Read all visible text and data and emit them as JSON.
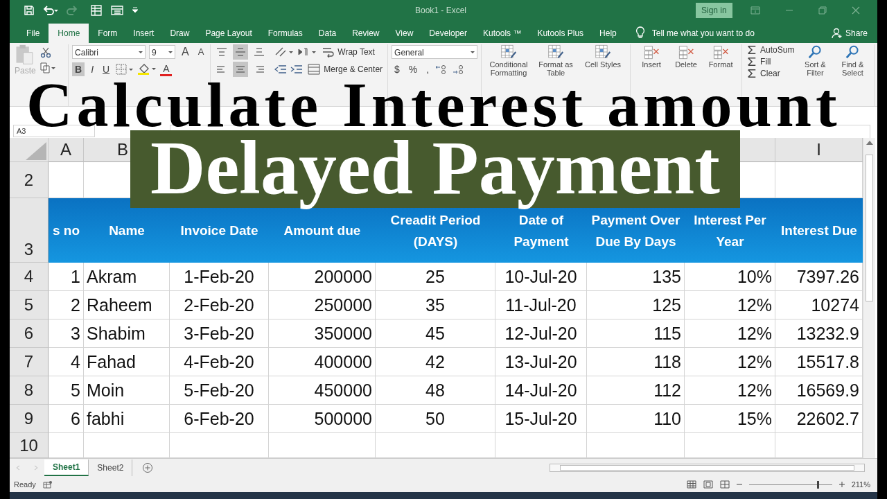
{
  "window": {
    "title": "Book1 - Excel",
    "sign_in": "Sign in"
  },
  "menu_tabs": [
    {
      "label": "File",
      "selected": false
    },
    {
      "label": "Home",
      "selected": true
    },
    {
      "label": "Form",
      "selected": false
    },
    {
      "label": "Insert",
      "selected": false
    },
    {
      "label": "Draw",
      "selected": false
    },
    {
      "label": "Page Layout",
      "selected": false
    },
    {
      "label": "Formulas",
      "selected": false
    },
    {
      "label": "Data",
      "selected": false
    },
    {
      "label": "Review",
      "selected": false
    },
    {
      "label": "View",
      "selected": false
    },
    {
      "label": "Developer",
      "selected": false
    },
    {
      "label": "Kutools ™",
      "selected": false
    },
    {
      "label": "Kutools Plus",
      "selected": false
    },
    {
      "label": "Help",
      "selected": false
    }
  ],
  "tell_me": "Tell me what you want to do",
  "share": "Share",
  "clipboard": {
    "paste": "Paste"
  },
  "font": {
    "name": "Calibri",
    "size": "9",
    "grow": "A",
    "shrink": "A",
    "font_color": "A",
    "styles": [
      {
        "label": "B",
        "pressed": true
      },
      {
        "label": "I",
        "pressed": false
      },
      {
        "label": "U",
        "pressed": false
      }
    ]
  },
  "alignment": {
    "vertical": [
      {
        "kind": "top",
        "pressed": false
      },
      {
        "kind": "middle",
        "pressed": true
      },
      {
        "kind": "bottom",
        "pressed": false
      }
    ],
    "horizontal": [
      {
        "kind": "left",
        "pressed": false
      },
      {
        "kind": "center",
        "pressed": true
      },
      {
        "kind": "right",
        "pressed": false
      }
    ],
    "wrap_text": "Wrap Text",
    "merge": "Merge & Center"
  },
  "number": {
    "format": "General",
    "symbols": [
      "$",
      "%",
      ","
    ]
  },
  "styles": [
    "Conditional Formatting",
    "Format as Table",
    "Cell Styles"
  ],
  "cells": [
    "Insert",
    "Delete",
    "Format"
  ],
  "editing": {
    "small": [
      "AutoSum",
      "Fill",
      "Clear"
    ],
    "large": [
      "Sort & Filter",
      "Find & Select"
    ]
  },
  "name_box": "A3",
  "column_headers": [
    "A",
    "B",
    "I"
  ],
  "table": {
    "row_2": "2",
    "header_row": "3",
    "columns": [
      "s no",
      "Name",
      "Invoice Date",
      "Amount due",
      "Creadit Period (DAYS)",
      "Date of Payment",
      "Payment Over Due By Days",
      "Interest Per Year",
      "Interest Due"
    ],
    "rows": [
      {
        "row": "4",
        "cells": [
          "1",
          "Akram",
          "1-Feb-20",
          "200000",
          "25",
          "10-Jul-20",
          "135",
          "10%",
          "7397.26"
        ]
      },
      {
        "row": "5",
        "cells": [
          "2",
          "Raheem",
          "2-Feb-20",
          "250000",
          "35",
          "11-Jul-20",
          "125",
          "12%",
          "10274"
        ]
      },
      {
        "row": "6",
        "cells": [
          "3",
          "Shabim",
          "3-Feb-20",
          "350000",
          "45",
          "12-Jul-20",
          "115",
          "12%",
          "13232.9"
        ]
      },
      {
        "row": "7",
        "cells": [
          "4",
          "Fahad",
          "4-Feb-20",
          "400000",
          "42",
          "13-Jul-20",
          "118",
          "12%",
          "15517.8"
        ]
      },
      {
        "row": "8",
        "cells": [
          "5",
          "Moin",
          "5-Feb-20",
          "450000",
          "48",
          "14-Jul-20",
          "112",
          "12%",
          "16569.9"
        ]
      },
      {
        "row": "9",
        "cells": [
          "6",
          "fabhi",
          "6-Feb-20",
          "500000",
          "50",
          "15-Jul-20",
          "110",
          "15%",
          "22602.7"
        ]
      }
    ],
    "row_10": "10"
  },
  "sheet_tabs": [
    {
      "label": "Sheet1",
      "selected": true
    },
    {
      "label": "Sheet2",
      "selected": false
    }
  ],
  "status": {
    "ready": "Ready",
    "zoom": "211%",
    "level": 0.82
  },
  "overlay": {
    "line_1": "Calculate Interest amount",
    "line_2": "Delayed Payment"
  }
}
